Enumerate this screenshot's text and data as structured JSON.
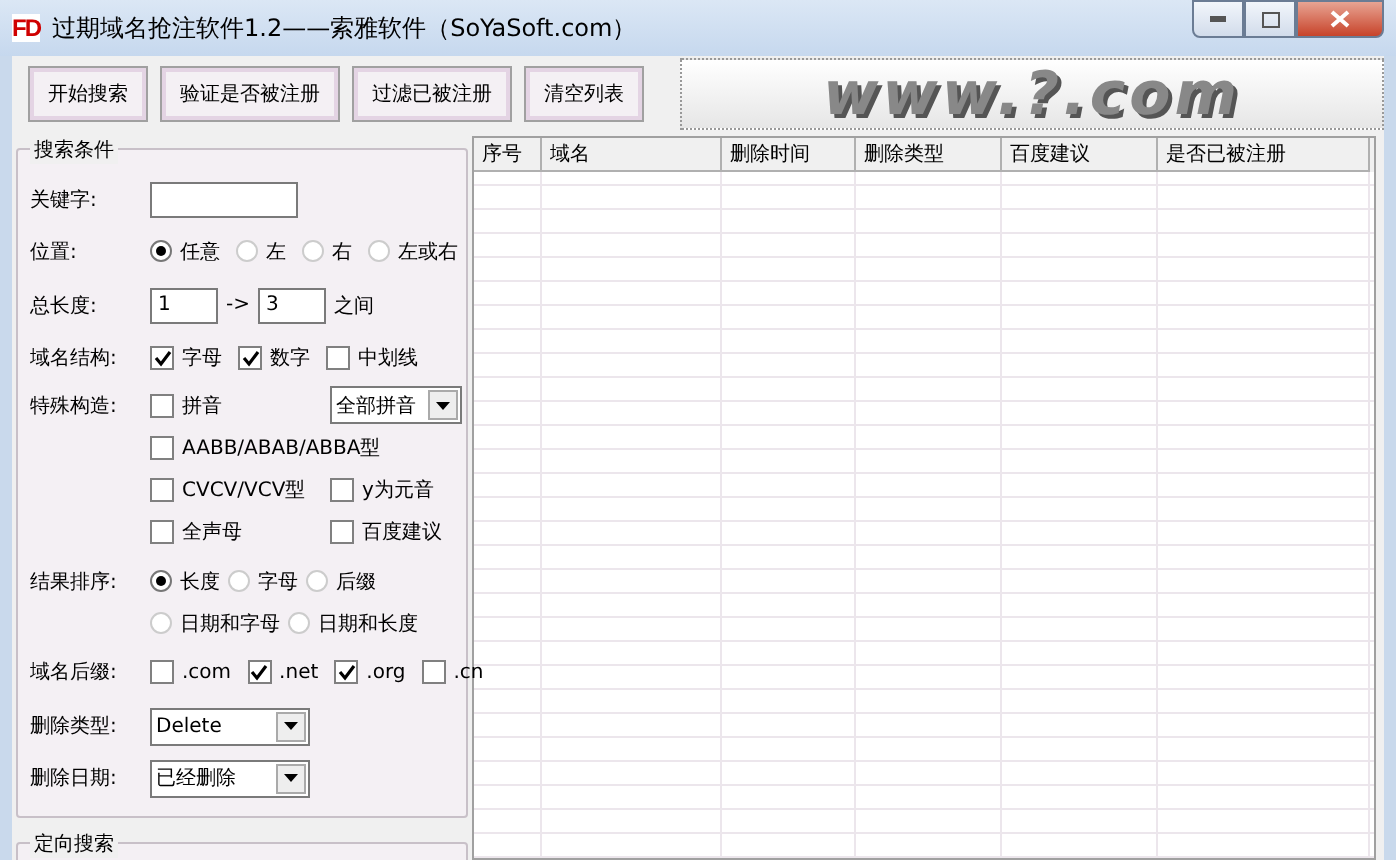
{
  "window": {
    "app_icon": "FD",
    "title": "过期域名抢注软件1.2——索雅软件（SoYaSoft.com）"
  },
  "toolbar": {
    "buttons": [
      "开始搜索",
      "验证是否被注册",
      "过滤已被注册",
      "清空列表"
    ],
    "banner": "www.?.com"
  },
  "search": {
    "title": "搜索条件",
    "keyword": {
      "label": "关键字:"
    },
    "position": {
      "label": "位置:",
      "options": [
        {
          "label": "任意",
          "selected": true
        },
        {
          "label": "左",
          "selected": false
        },
        {
          "label": "右",
          "selected": false
        },
        {
          "label": "左或右",
          "selected": false
        }
      ]
    },
    "length": {
      "label": "总长度:",
      "from": "1",
      "arrow": "->",
      "to": "3",
      "suffix": "之间"
    },
    "structure": {
      "label": "域名结构:",
      "options": [
        {
          "label": "字母",
          "checked": true
        },
        {
          "label": "数字",
          "checked": true
        },
        {
          "label": "中划线",
          "checked": false
        }
      ]
    },
    "special": {
      "label": "特殊构造:",
      "rows": [
        [
          {
            "kind": "checkbox",
            "label": "拼音",
            "checked": false
          },
          {
            "kind": "select",
            "value": "全部拼音"
          }
        ],
        [
          {
            "kind": "checkbox",
            "label": "AABB/ABAB/ABBA型",
            "checked": false
          }
        ],
        [
          {
            "kind": "checkbox",
            "label": "CVCV/VCV型",
            "checked": false
          },
          {
            "kind": "checkbox",
            "label": "y为元音",
            "checked": false
          }
        ],
        [
          {
            "kind": "checkbox",
            "label": "全声母",
            "checked": false
          },
          {
            "kind": "checkbox",
            "label": "百度建议",
            "checked": false
          }
        ]
      ]
    },
    "sort": {
      "label": "结果排序:",
      "options": [
        {
          "label": "长度",
          "selected": true
        },
        {
          "label": "字母",
          "selected": false
        },
        {
          "label": "后缀",
          "selected": false
        },
        {
          "label": "日期和字母",
          "selected": false
        },
        {
          "label": "日期和长度",
          "selected": false
        }
      ]
    },
    "suffix": {
      "label": "域名后缀:",
      "options": [
        {
          "label": ".com",
          "checked": false
        },
        {
          "label": ".net",
          "checked": true
        },
        {
          "label": ".org",
          "checked": true
        },
        {
          "label": ".cn",
          "checked": false
        }
      ]
    },
    "delete_type": {
      "label": "删除类型:",
      "value": "Delete"
    },
    "delete_date": {
      "label": "删除日期:",
      "value": "已经删除"
    }
  },
  "targeted": {
    "title": "定向搜索"
  },
  "table": {
    "columns": [
      "序号",
      "域名",
      "删除时间",
      "删除类型",
      "百度建议",
      "是否已被注册"
    ]
  }
}
